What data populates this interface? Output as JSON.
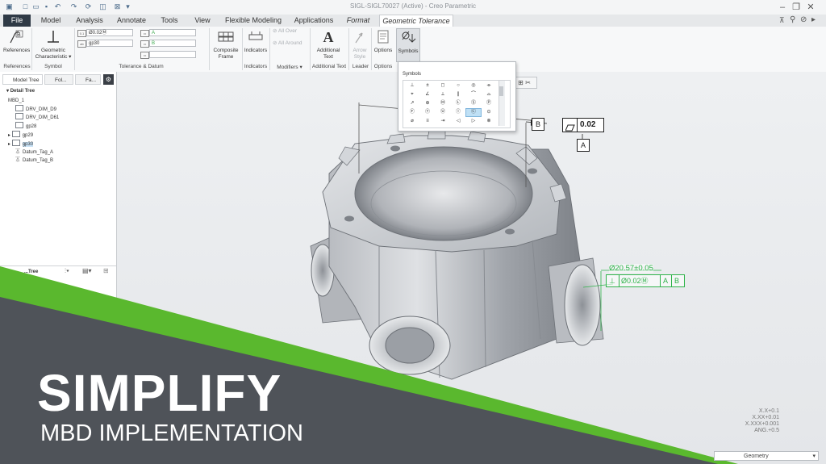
{
  "window": {
    "title": "SIGL-SIGL70027 (Active) - Creo Parametric"
  },
  "quick_access": [
    "new-icon",
    "open-icon",
    "save-icon",
    "undo-icon",
    "redo-icon",
    "regenerate-icon",
    "windows-icon",
    "close-window-icon",
    "customize-icon"
  ],
  "menu_tabs": [
    {
      "label": "File"
    },
    {
      "label": "Model"
    },
    {
      "label": "Analysis"
    },
    {
      "label": "Annotate"
    },
    {
      "label": "Tools"
    },
    {
      "label": "View"
    },
    {
      "label": "Flexible Modeling"
    },
    {
      "label": "Applications"
    },
    {
      "label": "Format"
    },
    {
      "label": "Geometric Tolerance"
    }
  ],
  "ribbon": {
    "references": {
      "label": "References"
    },
    "geom_char": {
      "label": "Geometric Characteristic"
    },
    "tol_value": "Ø0.02Ⓜ",
    "tol_name": "gp30",
    "datum_primary": "A",
    "datum_secondary": "B",
    "datum_tertiary": "",
    "composite": {
      "label": "Composite Frame"
    },
    "indicators": {
      "label": "Indicators"
    },
    "all_over": {
      "label": "All Over"
    },
    "all_around": {
      "label": "All Around"
    },
    "additional_text": {
      "label": "Additional Text"
    },
    "arrow_style": {
      "label": "Arrow Style"
    },
    "options": {
      "label": "Options"
    },
    "symbols": {
      "label": "Symbols"
    },
    "groups": {
      "references": "References",
      "symbol": "Symbol",
      "tol_datum": "Tolerance & Datum",
      "indicators": "Indicators",
      "modifiers": "Modifiers ▾",
      "additional_text": "Additional Text",
      "leader": "Leader",
      "options": "Options"
    }
  },
  "symbols_popup": {
    "title": "Symbols",
    "symbols": [
      "⊥",
      "±",
      "◻",
      "○",
      "◎",
      "⌯",
      "⌖",
      "∠",
      "⟂",
      "∥",
      "⌒",
      "⌓",
      "↗",
      "⊕",
      "Ⓜ",
      "Ⓛ",
      "Ⓢ",
      "Ⓟ",
      "Ⓕ",
      "Ⓣ",
      "Ⓤ",
      "Ⓘ",
      "Ⓒ",
      "⊙",
      "⌀",
      "≡",
      "⇥",
      "◁",
      "▷",
      "⊗"
    ]
  },
  "left_panel": {
    "tabs": [
      "Model Tree",
      "Fol...",
      "Fa..."
    ],
    "tree_header": "Detail Tree",
    "items": [
      {
        "label": "MBD_1"
      },
      {
        "label": "DRV_DIM_D9"
      },
      {
        "label": "DRV_DIM_D61"
      },
      {
        "label": "gp28"
      },
      {
        "label": "gp29"
      },
      {
        "label": "gp30"
      },
      {
        "label": "Datum_Tag_A"
      },
      {
        "label": "Datum_Tag_B"
      }
    ],
    "lower_header": "...Tree"
  },
  "annotations": {
    "datum_b": "B",
    "flatness_value": "0.02",
    "datum_a": "A",
    "diameter_dim": "Ø20.57±0.05",
    "position_value": "Ø0.02Ⓜ",
    "pos_datum_a": "A",
    "pos_datum_b": "B"
  },
  "status": {
    "tol_lines": [
      "X.X+0.1",
      "X.XX+0.01",
      "X.XXX+0.001",
      "ANG.+0.5"
    ],
    "filter": "Geometry"
  },
  "banner": {
    "title": "SIMPLIFY",
    "subtitle": "MBD IMPLEMENTATION"
  },
  "colors": {
    "green": "#5ab82e",
    "banner_gray": "#4f5359",
    "annotation_green": "#2fb34a",
    "dark_tab": "#2f3a46"
  }
}
